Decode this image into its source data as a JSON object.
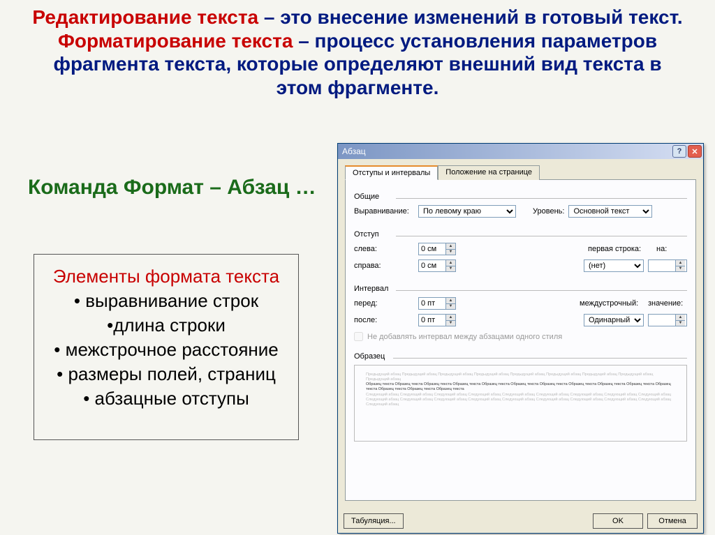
{
  "slide": {
    "def1_term": "Редактирование текста",
    "def1_rest": " – это внесение изменений в готовый текст.",
    "def2_term": "Форматирование текста",
    "def2_rest": " – процесс установления параметров фрагмента текста, которые определяют внешний вид текста в этом фрагменте.",
    "command": "Команда Формат – Абзац …",
    "elements_title": "Элементы формата текста",
    "elements": [
      "выравнивание строк",
      "длина строки",
      "межстрочное расстояние",
      "размеры полей, страниц",
      "абзацные отступы"
    ]
  },
  "dialog": {
    "title": "Абзац",
    "tabs": {
      "active": "Отступы и интервалы",
      "other": "Положение на странице"
    },
    "groups": {
      "general": "Общие",
      "indent": "Отступ",
      "spacing": "Интервал",
      "preview": "Образец"
    },
    "general": {
      "align_label": "Выравнивание:",
      "align_value": "По левому краю",
      "level_label": "Уровень:",
      "level_value": "Основной текст"
    },
    "indent": {
      "left_label": "слева:",
      "left_value": "0 см",
      "right_label": "справа:",
      "right_value": "0 см",
      "first_label": "первая строка:",
      "first_value": "(нет)",
      "by_label": "на:",
      "by_value": ""
    },
    "spacing": {
      "before_label": "перед:",
      "before_value": "0 пт",
      "after_label": "после:",
      "after_value": "0 пт",
      "line_label": "междустрочный:",
      "line_value": "Одинарный",
      "at_label": "значение:",
      "at_value": ""
    },
    "checkbox": "Не добавлять интервал между абзацами одного стиля",
    "footer": {
      "tabs_btn": "Табуляция...",
      "ok": "OK",
      "cancel": "Отмена"
    }
  }
}
